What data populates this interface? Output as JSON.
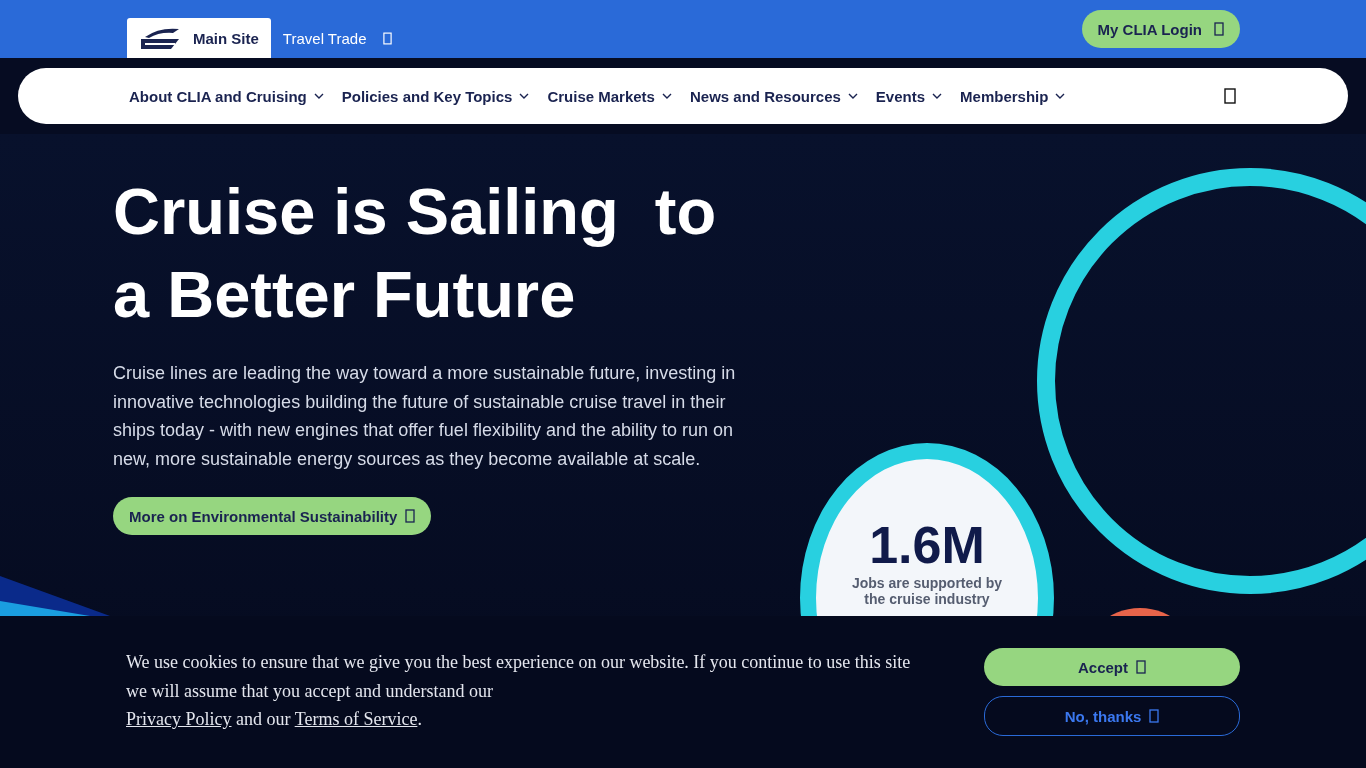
{
  "top_bar": {
    "tabs": [
      {
        "label": "Main Site",
        "selected": true
      },
      {
        "label": "Travel Trade",
        "selected": false
      }
    ],
    "login_button": "My CLIA Login"
  },
  "nav": {
    "items": [
      "About CLIA and Cruising",
      "Policies and Key Topics",
      "Cruise Markets",
      "News and Resources",
      "Events",
      "Membership"
    ]
  },
  "hero": {
    "title_lines": [
      "Cruise is Sailing  to",
      "a Better Future"
    ],
    "text": "Cruise lines are leading the way toward a more sustainable future, investing in innovative technologies building the future of sustainable cruise travel in their ships today - with new engines that offer fuel flexibility and the ability to run on new, more sustainable energy sources as they become available at scale.",
    "button": "More on Environmental Sustainability",
    "stat": {
      "value": "1.6M",
      "label": "Jobs are supported by the cruise industry"
    }
  },
  "cookie_banner": {
    "text_before": "We use cookies to ensure that we give you the best experience on our website. If you continue to use this site we will assume that you accept and understand our",
    "privacy_link": "Privacy Policy",
    "text_middle": "and our",
    "terms_link": "Terms of Service",
    "text_end": ".",
    "accept_button": "Accept",
    "decline_button": "No, thanks"
  }
}
